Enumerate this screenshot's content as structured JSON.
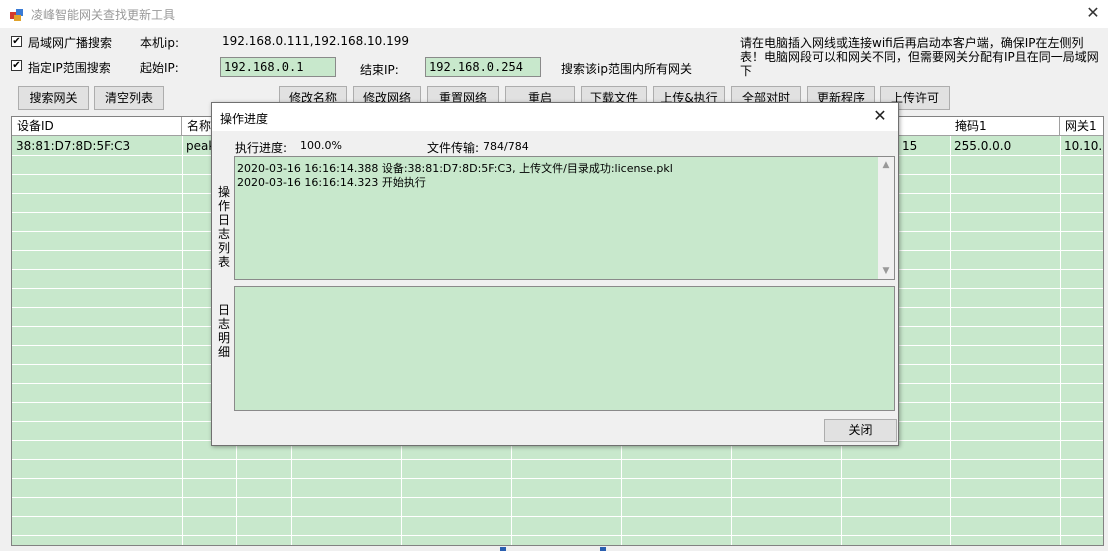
{
  "window": {
    "title": "凌峰智能网关查找更新工具",
    "close_glyph": "✕"
  },
  "options": {
    "broadcast_search": {
      "label": "局域网广播搜索",
      "checked": true
    },
    "range_search": {
      "label": "指定IP范围搜索",
      "checked": true
    },
    "local_ip_label": "本机ip:",
    "local_ip_value": "192.168.0.111,192.168.10.199",
    "start_ip_label": "起始IP:",
    "start_ip_value": "192.168.0.1",
    "end_ip_label": "结束IP:",
    "end_ip_value": "192.168.0.254",
    "range_hint": "搜索该ip范围内所有网关",
    "notice": "请在电脑插入网线或连接wifi后再启动本客户端，确保IP在左侧列表！电脑网段可以和网关不同，但需要网关分配有IP且在同一局域网下"
  },
  "toolbar": {
    "search_label": "搜索网关",
    "clear_label": "清空列表",
    "buttons": [
      "修改名称",
      "修改网络",
      "重置网络",
      "重启",
      "下载文件",
      "上传&执行",
      "全部对时",
      "更新程序",
      "上传许可"
    ]
  },
  "grid": {
    "columns": [
      "设备ID",
      "名称",
      "掩码1",
      "网关1"
    ],
    "row": {
      "device_id": "38:81:D7:8D:5F:C3",
      "name": "peak",
      "ip_tail": "15",
      "mask": "255.0.0.0",
      "gateway": "10.10."
    }
  },
  "dialog": {
    "title": "操作进度",
    "close_glyph": "✕",
    "progress_label": "执行进度:",
    "progress_value": "100.0%",
    "transfer_label": "文件传输:",
    "transfer_value": "784/784",
    "log_list_label": "操作日志列表",
    "log_detail_label": "日志明细",
    "log_lines": [
      "2020-03-16 16:16:14.388  设备:38:81:D7:8D:5F:C3, 上传文件/目录成功:license.pkl",
      "2020-03-16 16:16:14.323  开始执行"
    ],
    "close_button": "关闭"
  },
  "icons": {
    "checkbox_checked": "✔",
    "scroll_up": "▲",
    "scroll_down": "▼"
  }
}
